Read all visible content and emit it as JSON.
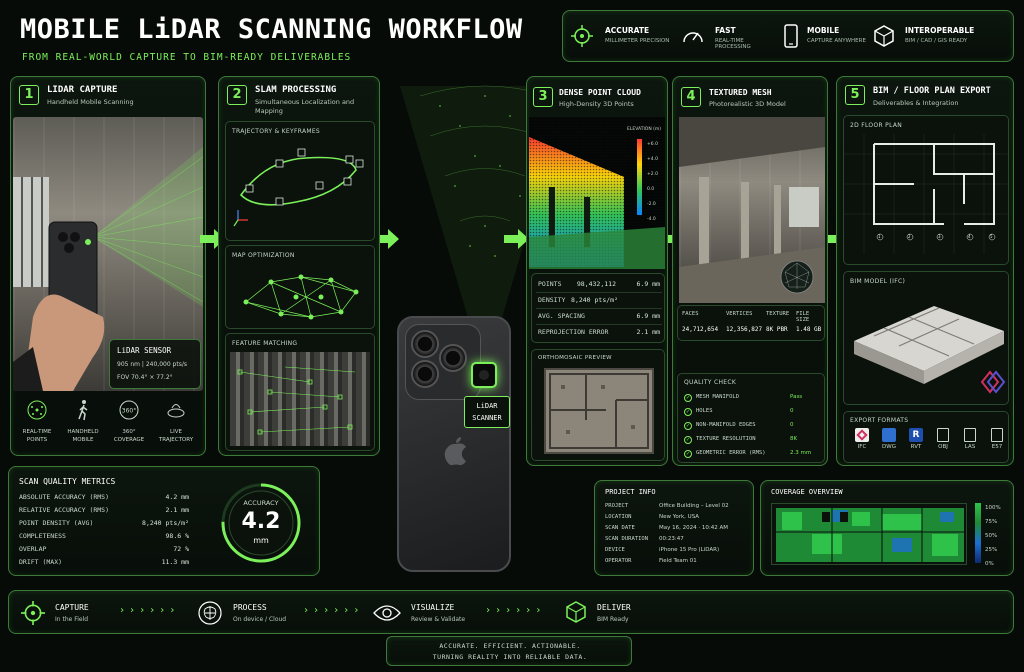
{
  "header": {
    "title": "MOBILE LiDAR SCANNING WORKFLOW",
    "subtitle": "FROM REAL-WORLD CAPTURE TO BIM-READY DELIVERABLES",
    "features": [
      {
        "icon": "crosshair-icon",
        "title": "ACCURATE",
        "sub": "MILLIMETER PRECISION"
      },
      {
        "icon": "speedometer-icon",
        "title": "FAST",
        "sub": "REAL-TIME PROCESSING"
      },
      {
        "icon": "phone-icon",
        "title": "MOBILE",
        "sub": "CAPTURE ANYWHERE"
      },
      {
        "icon": "cube-icon",
        "title": "INTEROPERABLE",
        "sub": "BIM / CAD / GIS READY"
      }
    ]
  },
  "step1": {
    "num": "1",
    "title": "LiDAR CAPTURE",
    "sub": "Handheld Mobile Scanning",
    "sensor": {
      "title": "LiDAR SENSOR",
      "line1": "905 nm | 240,000 pts/s",
      "line2": "FOV 70.4° × 77.2°"
    },
    "icons": [
      {
        "icon": "points-icon",
        "label": "REAL-TIME POINTS"
      },
      {
        "icon": "walking-icon",
        "label": "HANDHELD MOBILE"
      },
      {
        "icon": "360-icon",
        "label": "360° COVERAGE"
      },
      {
        "icon": "trajectory-icon",
        "label": "LIVE TRAJECTORY"
      }
    ]
  },
  "step2": {
    "num": "2",
    "title": "SLAM PROCESSING",
    "sub": "Simultaneous Localization and Mapping",
    "panels": [
      "TRAJECTORY & KEYFRAMES",
      "MAP OPTIMIZATION",
      "FEATURE MATCHING"
    ]
  },
  "step3": {
    "num": "3",
    "title": "DENSE POINT CLOUD",
    "sub": "High-Density 3D Points",
    "elevation_label": "ELEVATION (m)",
    "elevation_ticks": [
      "+6.0",
      "+4.0",
      "+2.0",
      "0.0",
      "-2.0",
      "-4.0"
    ],
    "stats": [
      {
        "label": "POINTS",
        "value": "98,432,112",
        "value2": "6.9 mm"
      },
      {
        "label": "DENSITY",
        "value": "8,240 pts/m²",
        "value2": ""
      },
      {
        "label": "AVG. SPACING",
        "value": "",
        "value2": "6.9 mm"
      },
      {
        "label": "REPROJECTION ERROR",
        "value": "",
        "value2": "2.1 mm"
      }
    ],
    "ortho_label": "ORTHOMOSAIC PREVIEW"
  },
  "step4": {
    "num": "4",
    "title": "TEXTURED MESH",
    "sub": "Photorealistic 3D Model",
    "mesh_headers": [
      "FACES",
      "VERTICES",
      "TEXTURE",
      "FILE SIZE"
    ],
    "mesh_values": [
      "24,712,654",
      "12,356,827",
      "8K PBR",
      "1.48 GB"
    ],
    "quality_title": "QUALITY CHECK",
    "quality": [
      {
        "label": "MESH MANIFOLD",
        "value": "Pass"
      },
      {
        "label": "HOLES",
        "value": "0"
      },
      {
        "label": "NON-MANIFOLD EDGES",
        "value": "0"
      },
      {
        "label": "TEXTURE RESOLUTION",
        "value": "8K"
      },
      {
        "label": "GEOMETRIC ERROR (RMS)",
        "value": "2.3 mm"
      }
    ]
  },
  "step5": {
    "num": "5",
    "title": "BIM / FLOOR PLAN EXPORT",
    "sub": "Deliverables & Integration",
    "floor_label": "2D FLOOR PLAN",
    "bim_label": "BIM MODEL (IFC)",
    "export_label": "EXPORT FORMATS",
    "formats": [
      "IFC",
      "DWG",
      "RVT",
      "OBJ",
      "LAS",
      "E57"
    ]
  },
  "phone": {
    "label": "LiDAR SCANNER"
  },
  "metrics": {
    "title": "SCAN QUALITY METRICS",
    "rows": [
      {
        "label": "ABSOLUTE ACCURACY (RMS)",
        "value": "4.2 mm"
      },
      {
        "label": "RELATIVE ACCURACY (RMS)",
        "value": "2.1 mm"
      },
      {
        "label": "POINT DENSITY (AVG)",
        "value": "8,240 pts/m²"
      },
      {
        "label": "COMPLETENESS",
        "value": "98.6 %"
      },
      {
        "label": "OVERLAP",
        "value": "72 %"
      },
      {
        "label": "DRIFT (MAX)",
        "value": "11.3 mm"
      }
    ],
    "gauge_label": "ACCURACY",
    "gauge_value": "4.2",
    "gauge_unit": "mm"
  },
  "project": {
    "title": "PROJECT INFO",
    "rows": [
      {
        "label": "PROJECT",
        "value": "Office Building – Level 02"
      },
      {
        "label": "LOCATION",
        "value": "New York, USA"
      },
      {
        "label": "SCAN DATE",
        "value": "May 16, 2024 · 10:42 AM"
      },
      {
        "label": "SCAN DURATION",
        "value": "00:23:47"
      },
      {
        "label": "DEVICE",
        "value": "iPhone 15 Pro (LiDAR)"
      },
      {
        "label": "OPERATOR",
        "value": "Field Team 01"
      }
    ]
  },
  "coverage": {
    "title": "COVERAGE OVERVIEW",
    "scale": [
      "100%",
      "75%",
      "50%",
      "25%",
      "0%"
    ]
  },
  "bottom": {
    "steps": [
      {
        "icon": "crosshair-icon",
        "title": "CAPTURE",
        "sub": "In the Field"
      },
      {
        "icon": "brain-icon",
        "title": "PROCESS",
        "sub": "On device / Cloud"
      },
      {
        "icon": "eye-icon",
        "title": "VISUALIZE",
        "sub": "Review & Validate"
      },
      {
        "icon": "box-icon",
        "title": "DELIVER",
        "sub": "BIM Ready"
      }
    ],
    "chevrons": "› › › › › ›",
    "tagline1": "ACCURATE. EFFICIENT. ACTIONABLE.",
    "tagline2": "TURNING REALITY INTO RELIABLE DATA."
  },
  "colors": {
    "accent": "#7cf05a",
    "background": "#070b08",
    "border": "#3d7a3a"
  }
}
